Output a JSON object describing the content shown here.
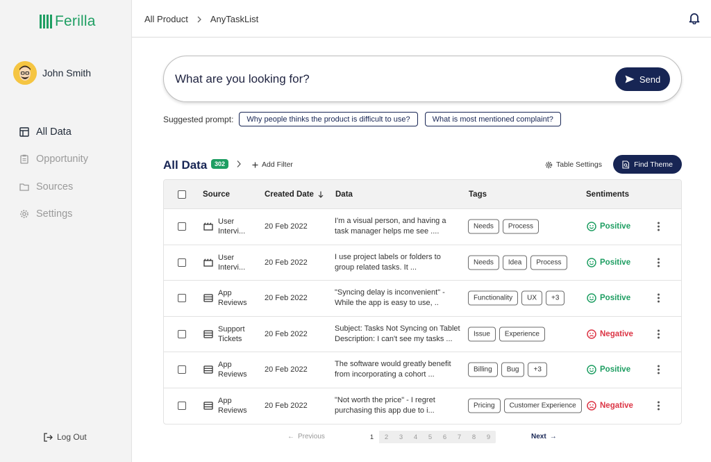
{
  "app": {
    "name": "Ferilla"
  },
  "user": {
    "name": "John Smith"
  },
  "nav": [
    {
      "label": "All Data",
      "icon": "table-icon",
      "active": true
    },
    {
      "label": "Opportunity",
      "icon": "clipboard-icon",
      "active": false
    },
    {
      "label": "Sources",
      "icon": "folder-icon",
      "active": false
    },
    {
      "label": "Settings",
      "icon": "gear-icon",
      "active": false
    }
  ],
  "logout_label": "Log Out",
  "breadcrumb": [
    "All Product",
    "AnyTaskList"
  ],
  "search": {
    "placeholder": "What are you looking for?",
    "send_label": "Send"
  },
  "suggested": {
    "label": "Suggested prompt:",
    "prompts": [
      "Why people thinks the product is difficult to use?",
      "What is most mentioned complaint?"
    ]
  },
  "data_section": {
    "title": "All Data",
    "count": "302",
    "add_filter": "Add Filter",
    "table_settings": "Table Settings",
    "find_theme": "Find Theme"
  },
  "table": {
    "headers": {
      "source": "Source",
      "date": "Created Date",
      "data": "Data",
      "tags": "Tags",
      "sentiments": "Sentiments"
    },
    "rows": [
      {
        "source_line1": "User",
        "source_line2": "Intervi...",
        "source_icon": "video-icon",
        "date": "20 Feb 2022",
        "data_line1": "I'm a visual person, and having a",
        "data_line2": "task manager helps me see ....",
        "tags": [
          "Needs",
          "Process"
        ],
        "sentiment": "Positive"
      },
      {
        "source_line1": "User",
        "source_line2": "Intervi...",
        "source_icon": "video-icon",
        "date": "20 Feb 2022",
        "data_line1": "I use project labels or folders to",
        "data_line2": "group related tasks. It ...",
        "tags": [
          "Needs",
          "Idea",
          "Process"
        ],
        "sentiment": "Positive"
      },
      {
        "source_line1": "App",
        "source_line2": "Reviews",
        "source_icon": "list-icon",
        "date": "20 Feb 2022",
        "data_line1": "\"Syncing delay is inconvenient\" -",
        "data_line2": "While the app is easy to use, ..",
        "tags": [
          "Functionality",
          "UX",
          "+3"
        ],
        "sentiment": "Positive"
      },
      {
        "source_line1": "Support",
        "source_line2": "Tickets",
        "source_icon": "list-icon",
        "date": "20 Feb 2022",
        "data_line1": "Subject: Tasks Not Syncing on Tablet",
        "data_line2": "Description: I can't see my tasks ...",
        "tags": [
          "Issue",
          "Experience"
        ],
        "sentiment": "Negative"
      },
      {
        "source_line1": "App",
        "source_line2": "Reviews",
        "source_icon": "list-icon",
        "date": "20 Feb 2022",
        "data_line1": "The software would greatly benefit",
        "data_line2": "from incorporating a cohort ...",
        "tags": [
          "Billing",
          "Bug",
          "+3"
        ],
        "sentiment": "Positive"
      },
      {
        "source_line1": "App",
        "source_line2": "Reviews",
        "source_icon": "list-icon",
        "date": "20 Feb 2022",
        "data_line1": "\"Not worth the price\" - I regret",
        "data_line2": "purchasing this app due to i...",
        "tags": [
          "Pricing",
          "Customer Experience"
        ],
        "sentiment": "Negative"
      }
    ]
  },
  "pagination": {
    "previous": "Previous",
    "next": "Next",
    "pages": [
      "1",
      "2",
      "3",
      "4",
      "5",
      "6",
      "7",
      "8",
      "9"
    ],
    "current": "1"
  },
  "colors": {
    "brand": "#1e9e62",
    "primary": "#172554",
    "positive": "#1e9e62",
    "negative": "#dc3545"
  }
}
